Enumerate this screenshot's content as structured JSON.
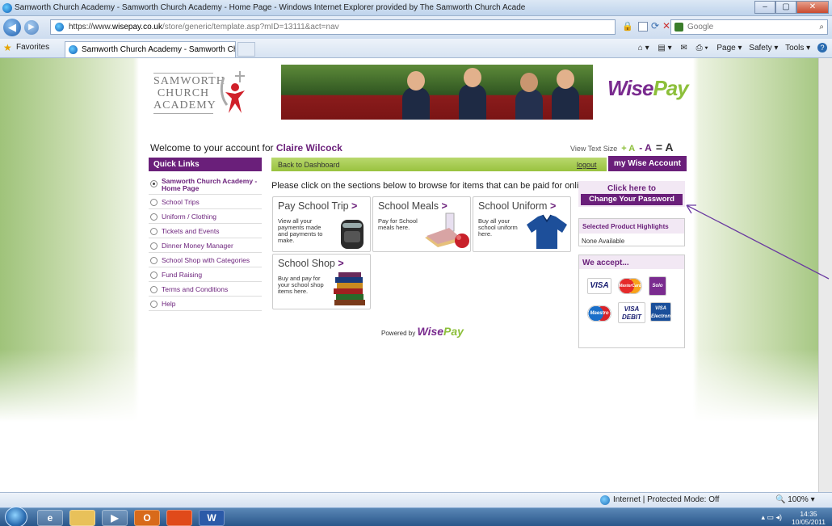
{
  "window": {
    "title": "Samworth Church Academy - Samworth Church Academy - Home Page - Windows Internet Explorer provided by The Samworth Church Acade",
    "min": "–",
    "max": "▢",
    "close": "✕"
  },
  "address_bar": {
    "scheme": "https://www.",
    "domain": "wisepay.co.uk",
    "path": "/store/generic/template.asp?mID=13111&act=nav",
    "search_placeholder": "Google"
  },
  "favorites_bar": {
    "favorites_label": "Favorites",
    "tab_title": "Samworth Church Academy - Samworth Church ..."
  },
  "command_bar": {
    "items": [
      "Page ▾",
      "Safety ▾",
      "Tools ▾"
    ]
  },
  "banner": {
    "school_logo_lines": [
      "SAMWORTH",
      "CHURCH",
      "ACADEMY"
    ],
    "wisepay_logo": [
      "Wise",
      "Pay"
    ]
  },
  "welcome": {
    "prefix": "Welcome  to your account for",
    "user_name": "Claire Wilcock"
  },
  "text_size": {
    "label": "View Text Size",
    "small": "+ A",
    "medium": "- A",
    "large": "= A"
  },
  "quick_links": {
    "heading": "Quick Links",
    "items": [
      "Samworth Church Academy - Home Page",
      "School Trips",
      "Uniform / Clothing",
      "Tickets and Events",
      "Dinner Money Manager",
      "School Shop with Categories",
      "Fund Raising",
      "Terms and Conditions",
      "Help"
    ]
  },
  "nav": {
    "back_to_dashboard": "Back to Dashboard",
    "logout": "logout",
    "my_account": "my Wise Account"
  },
  "main": {
    "instruction": "Please click on the sections below to browse for items that can be paid for online.",
    "cards": [
      {
        "title": "Pay School Trip",
        "desc": "View all your payments made and payments to make."
      },
      {
        "title": "School Meals",
        "desc": "Pay for School meals here."
      },
      {
        "title": "School Uniform",
        "desc": "Buy all your school uniform here."
      },
      {
        "title": "School Shop",
        "desc": "Buy and pay for your school shop items here."
      }
    ],
    "arrow": ">",
    "powered_by": "Powered by",
    "powered_logo": [
      "Wise",
      "Pay"
    ]
  },
  "right_panel": {
    "click_here": "Click here to",
    "change_password": "Change Your Password",
    "highlights_heading": "Selected Product Highlights",
    "highlights_value": "None Available",
    "accept_heading": "We accept...",
    "card_brands": [
      "VISA",
      "MasterCard",
      "Solo",
      "Maestro",
      "VISA DEBIT",
      "VISA Electron"
    ]
  },
  "status_bar": {
    "zone": "Internet | Protected Mode: Off",
    "zoom": "100%"
  },
  "taskbar": {
    "time": "14:35",
    "date": "10/05/2011"
  },
  "colors": {
    "brand_purple": "#6a1f7a",
    "brand_green": "#8cbf3a"
  }
}
